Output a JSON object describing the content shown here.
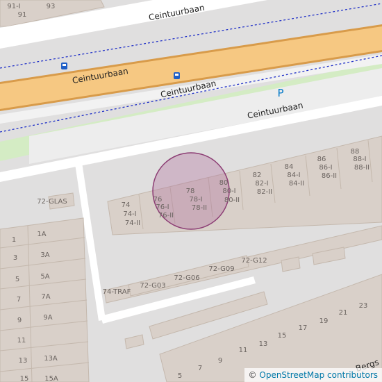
{
  "map": {
    "streets": [
      {
        "id": "ceintuurbaan-top",
        "name": "Ceintuurbaan"
      },
      {
        "id": "ceintuurbaan-main",
        "name": "Ceintuurbaan"
      },
      {
        "id": "ceintuurbaan-cycle",
        "name": "Ceintuurbaan"
      },
      {
        "id": "ceintuurbaan-service",
        "name": "Ceintuurbaan"
      },
      {
        "id": "bergstraat",
        "name": "Bergs"
      }
    ],
    "parking_label": "P",
    "icons": [
      "bus-stop-icon",
      "bus-stop-icon",
      "parking-icon"
    ],
    "colors": {
      "background": "#e0dfdf",
      "road": "#ffffff",
      "main_road": "#f6c882",
      "main_road_casing": "#d89b4a",
      "cycleway_area": "#d4ecc4",
      "bus_route": "#1f2fc7",
      "buildings": "#d9d0c9",
      "building_outline": "#c4b8ad",
      "highlight_fill": "#b06e9a",
      "highlight_stroke": "#8c3d74",
      "parking": "#0078c8"
    },
    "house_numbers": [
      "91-I",
      "91",
      "93",
      "88",
      "88-I",
      "88-II",
      "86",
      "86-I",
      "86-II",
      "84",
      "84-I",
      "84-II",
      "82",
      "82-I",
      "82-II",
      "80",
      "80-I",
      "80-II",
      "78",
      "78-I",
      "78-II",
      "76",
      "76-I",
      "76-II",
      "74",
      "74-I",
      "74-II",
      "72-GLAS",
      "72-G12",
      "72-G09",
      "72-G06",
      "72-G03",
      "74-TRAF",
      "1",
      "1A",
      "3",
      "3A",
      "5",
      "5A",
      "7",
      "7A",
      "9",
      "9A",
      "11",
      "13",
      "13A",
      "15",
      "15A",
      "5",
      "7",
      "9",
      "11",
      "13",
      "15",
      "17",
      "19",
      "21",
      "23"
    ],
    "highlight": {
      "label": "selected location"
    }
  },
  "attribution": {
    "symbol": "©",
    "text": "OpenStreetMap contributors"
  }
}
